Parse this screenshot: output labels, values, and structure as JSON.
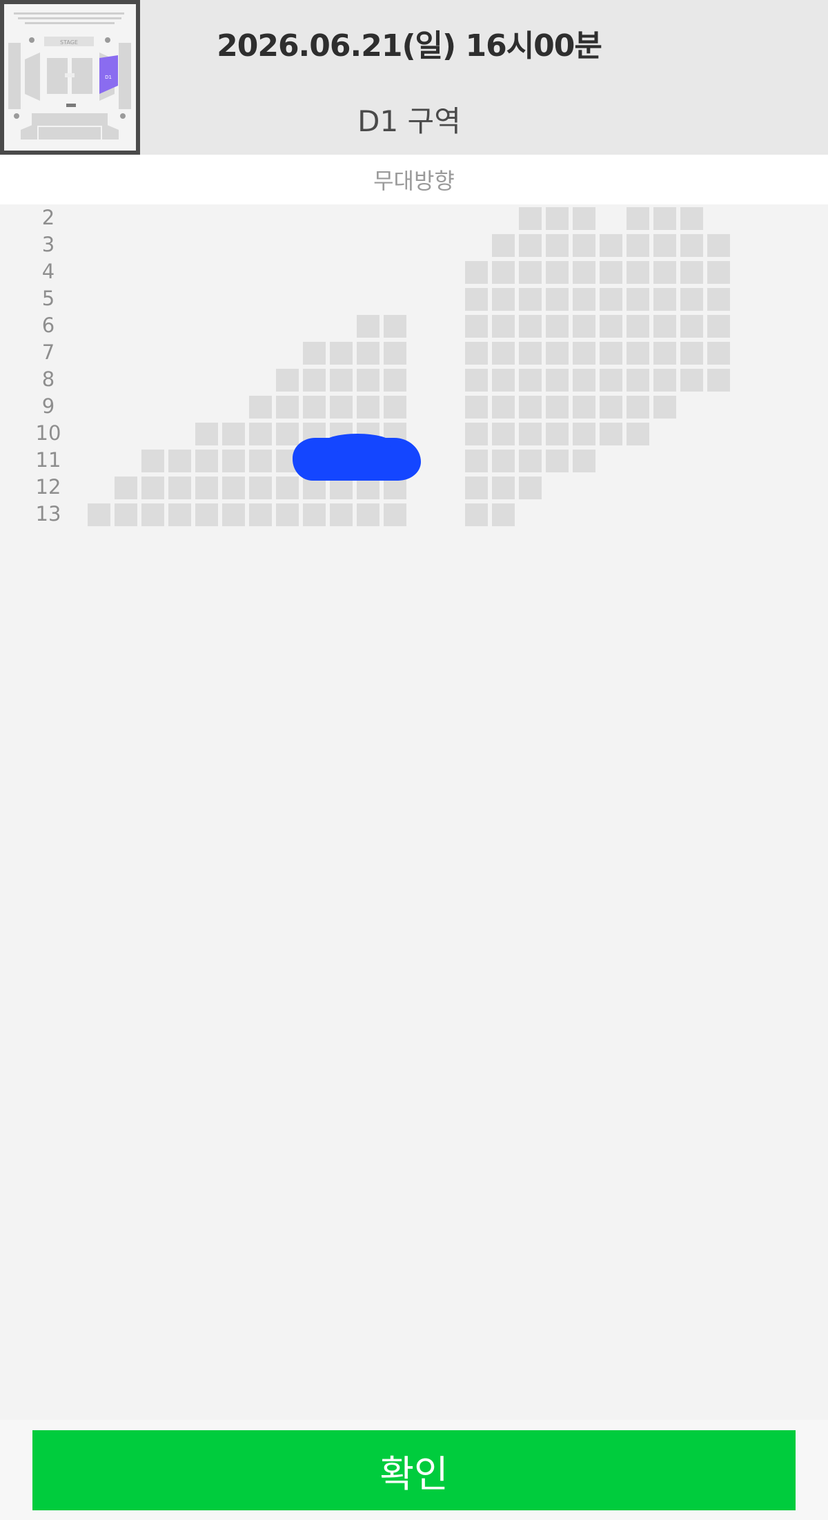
{
  "header": {
    "date_time": "2026.06.21(일) 16시00분",
    "section": "D1 구역"
  },
  "minimap": {
    "stage_label": "STAGE",
    "highlight_label": "D1",
    "highlight_color": "#8a6cf0"
  },
  "stage_direction": "무대방향",
  "seat_rows": [
    {
      "label": "2"
    },
    {
      "label": "3"
    },
    {
      "label": "4"
    },
    {
      "label": "5"
    },
    {
      "label": "6"
    },
    {
      "label": "7"
    },
    {
      "label": "8"
    },
    {
      "label": "9"
    },
    {
      "label": "10"
    },
    {
      "label": "11"
    },
    {
      "label": "12"
    },
    {
      "label": "13"
    }
  ],
  "colors": {
    "seat_available": "#dcdcdc",
    "confirm_button": "#00cc3d",
    "scribble": "#1446ff"
  },
  "footer": {
    "confirm_label": "확인"
  }
}
